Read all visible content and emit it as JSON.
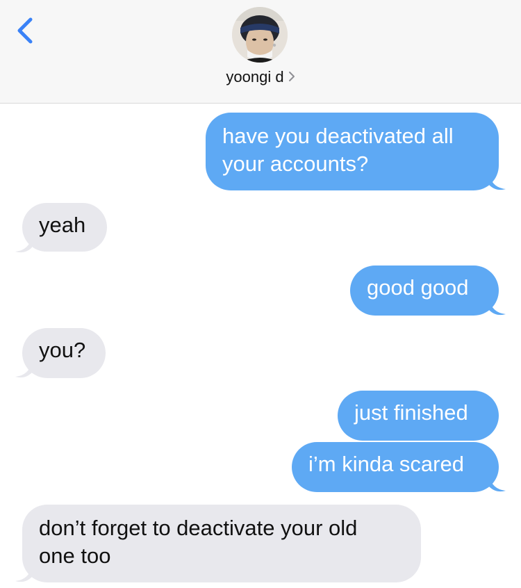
{
  "header": {
    "back_icon": "chevron-left-icon",
    "contact_name": "yoongi d",
    "contact_chevron_icon": "chevron-right-icon",
    "accent_color": "#3a82f7"
  },
  "messages": [
    {
      "direction": "outgoing",
      "text_line1": "have you deactivated all",
      "text_line2": "your accounts?"
    },
    {
      "direction": "incoming",
      "text": "yeah"
    },
    {
      "direction": "outgoing",
      "text": "good good"
    },
    {
      "direction": "incoming",
      "text": "you?"
    },
    {
      "direction": "outgoing",
      "text": "just finished"
    },
    {
      "direction": "outgoing",
      "text": "i’m kinda scared"
    },
    {
      "direction": "incoming",
      "text_line1": "don’t forget to deactivate your old",
      "text_line2": "one too"
    }
  ],
  "colors": {
    "outgoing_bubble": "#5ea9f4",
    "incoming_bubble": "#e8e8ed"
  }
}
